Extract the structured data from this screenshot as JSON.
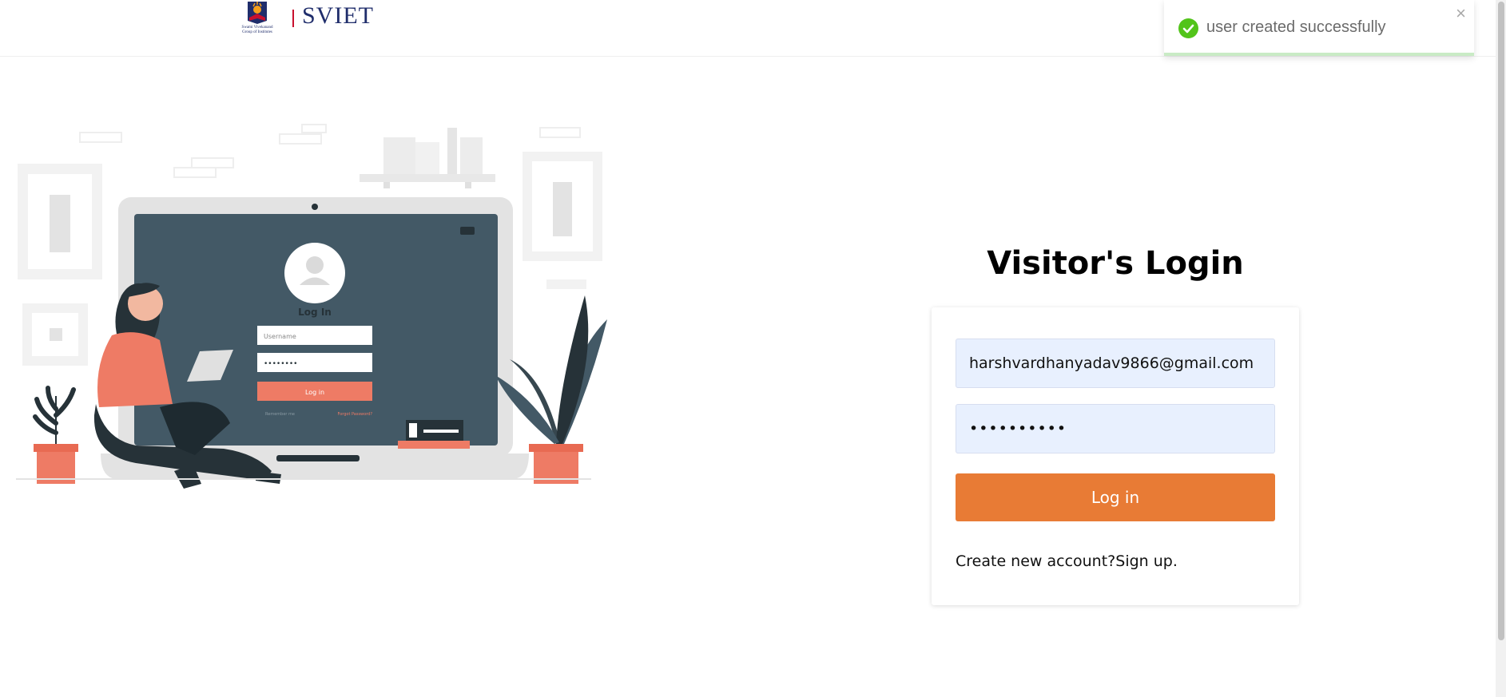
{
  "header": {
    "logo_text": "SVIET",
    "logo_subtitle_line1": "Swami Vivekanand",
    "logo_subtitle_line2": "Group of Institutes"
  },
  "toast": {
    "message": "user created successfully",
    "close_symbol": "×",
    "status_color": "#52c41a",
    "icon": "check-circle-icon"
  },
  "illustration": {
    "screen_title": "Log In",
    "username_placeholder": "Username",
    "password_mask": "••••••••",
    "login_button": "Log in",
    "remember_me": "Remember me",
    "forgot_password": "Forgot Password?"
  },
  "login": {
    "title": "Visitor's Login",
    "email_value": "harshvardhanyadav9866@gmail.com",
    "password_value": "••••••••••",
    "button_label": "Log in",
    "signup_prompt": "Create new account?",
    "signup_link": "Sign up.",
    "accent_color": "#e87b35"
  }
}
